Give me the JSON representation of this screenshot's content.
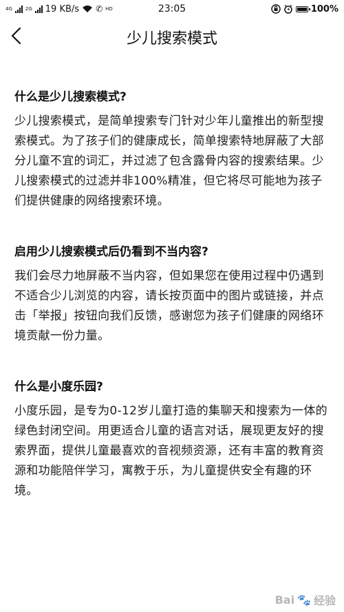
{
  "status_bar": {
    "network_labels": [
      "4G",
      "2G"
    ],
    "speed": "19 KB/s",
    "hd_label": "HD",
    "time": "23:05",
    "battery": "100%",
    "icons": [
      "signal-icon",
      "wifi-icon",
      "call-icon",
      "orientation-lock-icon",
      "alarm-icon",
      "battery-icon"
    ]
  },
  "header": {
    "title": "少儿搜索模式",
    "back_icon": "chevron-left-icon"
  },
  "sections": [
    {
      "heading": "什么是少儿搜索模式?",
      "body": "少儿搜索模式，是简单搜索专门针对少年儿童推出的新型搜索模式。为了孩子们的健康成长，简单搜索特地屏蔽了大部分儿童不宜的词汇，并过滤了包含露骨内容的搜索结果。少儿搜索模式的过滤并非100%精准，但它将尽可能地为孩子们提供健康的网络搜索环境。"
    },
    {
      "heading": "启用少儿搜索模式后仍看到不当内容?",
      "body": "我们会尽力地屏蔽不当内容，但如果您在使用过程中仍遇到不适合少儿浏览的内容，请长按页面中的图片或链接，并点击「举报」按钮向我们反馈，感谢您为孩子们健康的网络环境贡献一份力量。"
    },
    {
      "heading": "什么是小度乐园?",
      "body": "小度乐园，是专为0-12岁儿童打造的集聊天和搜索为一体的绿色封闭空间。用更适合儿童的语言对话，展现更友好的搜索界面，提供儿童最喜欢的音视频资源，还有丰富的教育资源和功能陪伴学习，寓教于乐，为儿童提供安全有趣的环境。"
    }
  ],
  "watermark": {
    "text": "Bai",
    "suffix": "经验"
  }
}
